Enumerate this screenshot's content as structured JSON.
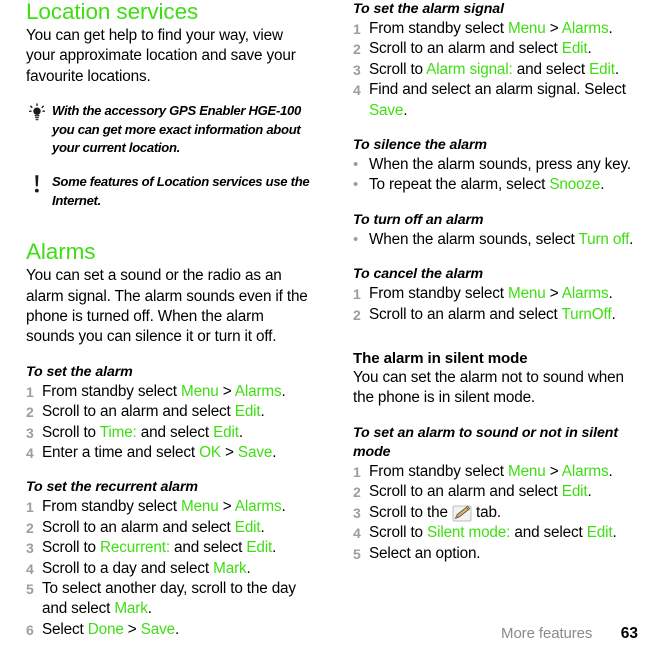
{
  "accent_green": "#3ede12",
  "muted_gray": "#9d9d9d",
  "left_column": {
    "section1": {
      "title": "Location services",
      "intro": "You can get help to find your way, view your approximate location and save your favourite locations.",
      "notes": [
        {
          "icon": "lightbulb-tip-icon",
          "text": "With the accessory GPS Enabler HGE-100 you can get more exact information about your current location."
        },
        {
          "icon": "exclamation-warning-icon",
          "text": "Some features of Location services use the Internet."
        }
      ]
    },
    "section2": {
      "title": "Alarms",
      "intro": "You can set a sound or the radio as an alarm signal. The alarm sounds even if the phone is turned off. When the alarm sounds you can silence it or turn it off.",
      "procedures": [
        {
          "heading": "To set the alarm",
          "style": "italic",
          "marker": "number",
          "steps": [
            {
              "n": "1",
              "parts": [
                {
                  "t": "From standby select ",
                  "g": false
                },
                {
                  "t": "Menu",
                  "g": true
                },
                {
                  "t": " > ",
                  "g": false
                },
                {
                  "t": "Alarms",
                  "g": true
                },
                {
                  "t": ".",
                  "g": false
                }
              ]
            },
            {
              "n": "2",
              "parts": [
                {
                  "t": "Scroll to an alarm and select ",
                  "g": false
                },
                {
                  "t": "Edit",
                  "g": true
                },
                {
                  "t": ".",
                  "g": false
                }
              ]
            },
            {
              "n": "3",
              "parts": [
                {
                  "t": "Scroll to ",
                  "g": false
                },
                {
                  "t": "Time:",
                  "g": true
                },
                {
                  "t": " and select ",
                  "g": false
                },
                {
                  "t": "Edit",
                  "g": true
                },
                {
                  "t": ".",
                  "g": false
                }
              ]
            },
            {
              "n": "4",
              "parts": [
                {
                  "t": "Enter a time and select ",
                  "g": false
                },
                {
                  "t": "OK",
                  "g": true
                },
                {
                  "t": " > ",
                  "g": false
                },
                {
                  "t": "Save",
                  "g": true
                },
                {
                  "t": ".",
                  "g": false
                }
              ]
            }
          ]
        },
        {
          "heading": "To set the recurrent alarm",
          "style": "italic",
          "marker": "number",
          "steps": [
            {
              "n": "1",
              "parts": [
                {
                  "t": "From standby select ",
                  "g": false
                },
                {
                  "t": "Menu",
                  "g": true
                },
                {
                  "t": " > ",
                  "g": false
                },
                {
                  "t": "Alarms",
                  "g": true
                },
                {
                  "t": ".",
                  "g": false
                }
              ]
            },
            {
              "n": "2",
              "parts": [
                {
                  "t": "Scroll to an alarm and select ",
                  "g": false
                },
                {
                  "t": "Edit",
                  "g": true
                },
                {
                  "t": ".",
                  "g": false
                }
              ]
            },
            {
              "n": "3",
              "parts": [
                {
                  "t": "Scroll to ",
                  "g": false
                },
                {
                  "t": "Recurrent:",
                  "g": true
                },
                {
                  "t": " and select ",
                  "g": false
                },
                {
                  "t": "Edit",
                  "g": true
                },
                {
                  "t": ".",
                  "g": false
                }
              ]
            },
            {
              "n": "4",
              "parts": [
                {
                  "t": "Scroll to a day and select ",
                  "g": false
                },
                {
                  "t": "Mark",
                  "g": true
                },
                {
                  "t": ".",
                  "g": false
                }
              ]
            },
            {
              "n": "5",
              "parts": [
                {
                  "t": "To select another day, scroll to the day and select ",
                  "g": false
                },
                {
                  "t": "Mark",
                  "g": true
                },
                {
                  "t": ".",
                  "g": false
                }
              ]
            },
            {
              "n": "6",
              "parts": [
                {
                  "t": "Select ",
                  "g": false
                },
                {
                  "t": "Done",
                  "g": true
                },
                {
                  "t": " > ",
                  "g": false
                },
                {
                  "t": "Save",
                  "g": true
                },
                {
                  "t": ".",
                  "g": false
                }
              ]
            }
          ]
        }
      ]
    }
  },
  "right_column": {
    "procedures": [
      {
        "heading": "To set the alarm signal",
        "style": "italic",
        "marker": "number",
        "steps": [
          {
            "n": "1",
            "parts": [
              {
                "t": "From standby select ",
                "g": false
              },
              {
                "t": "Menu",
                "g": true
              },
              {
                "t": " > ",
                "g": false
              },
              {
                "t": "Alarms",
                "g": true
              },
              {
                "t": ".",
                "g": false
              }
            ]
          },
          {
            "n": "2",
            "parts": [
              {
                "t": "Scroll to an alarm and select ",
                "g": false
              },
              {
                "t": "Edit",
                "g": true
              },
              {
                "t": ".",
                "g": false
              }
            ]
          },
          {
            "n": "3",
            "parts": [
              {
                "t": "Scroll to ",
                "g": false
              },
              {
                "t": "Alarm signal:",
                "g": true
              },
              {
                "t": " and select ",
                "g": false
              },
              {
                "t": "Edit",
                "g": true
              },
              {
                "t": ".",
                "g": false
              }
            ]
          },
          {
            "n": "4",
            "parts": [
              {
                "t": "Find and select an alarm signal. Select ",
                "g": false
              },
              {
                "t": "Save",
                "g": true
              },
              {
                "t": ".",
                "g": false
              }
            ]
          }
        ]
      },
      {
        "heading": "To silence the alarm",
        "style": "italic",
        "marker": "bullet",
        "steps": [
          {
            "n": "•",
            "parts": [
              {
                "t": "When the alarm sounds, press any key.",
                "g": false
              }
            ]
          },
          {
            "n": "•",
            "parts": [
              {
                "t": "To repeat the alarm, select ",
                "g": false
              },
              {
                "t": "Snooze",
                "g": true
              },
              {
                "t": ".",
                "g": false
              }
            ]
          }
        ]
      },
      {
        "heading": "To turn off an alarm",
        "style": "italic",
        "marker": "bullet",
        "steps": [
          {
            "n": "•",
            "parts": [
              {
                "t": "When the alarm sounds, select ",
                "g": false
              },
              {
                "t": "Turn off",
                "g": true
              },
              {
                "t": ".",
                "g": false
              }
            ]
          }
        ]
      },
      {
        "heading": "To cancel the alarm",
        "style": "italic",
        "marker": "number",
        "steps": [
          {
            "n": "1",
            "parts": [
              {
                "t": "From standby select ",
                "g": false
              },
              {
                "t": "Menu",
                "g": true
              },
              {
                "t": " > ",
                "g": false
              },
              {
                "t": "Alarms",
                "g": true
              },
              {
                "t": ".",
                "g": false
              }
            ]
          },
          {
            "n": "2",
            "parts": [
              {
                "t": "Scroll to an alarm and select ",
                "g": false
              },
              {
                "t": "TurnOff",
                "g": true
              },
              {
                "t": ".",
                "g": false
              }
            ]
          }
        ]
      }
    ],
    "silent_mode": {
      "heading": "The alarm in silent mode",
      "style": "bold",
      "intro": "You can set the alarm not to sound when the phone is in silent mode.",
      "procedure": {
        "heading": "To set an alarm to sound or not in silent mode",
        "style": "italic",
        "marker": "number",
        "steps": [
          {
            "n": "1",
            "parts": [
              {
                "t": "From standby select ",
                "g": false
              },
              {
                "t": "Menu",
                "g": true
              },
              {
                "t": " > ",
                "g": false
              },
              {
                "t": "Alarms",
                "g": true
              },
              {
                "t": ".",
                "g": false
              }
            ]
          },
          {
            "n": "2",
            "parts": [
              {
                "t": "Scroll to an alarm and select ",
                "g": false
              },
              {
                "t": "Edit",
                "g": true
              },
              {
                "t": ".",
                "g": false
              }
            ]
          },
          {
            "n": "3",
            "parts": [
              {
                "t": "Scroll to the ",
                "g": false
              },
              {
                "t": "__ICON__pencil-tab-icon",
                "g": false
              },
              {
                "t": " tab.",
                "g": false
              }
            ]
          },
          {
            "n": "4",
            "parts": [
              {
                "t": "Scroll to ",
                "g": false
              },
              {
                "t": "Silent mode:",
                "g": true
              },
              {
                "t": " and select ",
                "g": false
              },
              {
                "t": "Edit",
                "g": true
              },
              {
                "t": ".",
                "g": false
              }
            ]
          },
          {
            "n": "5",
            "parts": [
              {
                "t": "Select an option.",
                "g": false
              }
            ]
          }
        ]
      }
    }
  },
  "footer": {
    "chapter": "More features",
    "page_number": "63"
  }
}
